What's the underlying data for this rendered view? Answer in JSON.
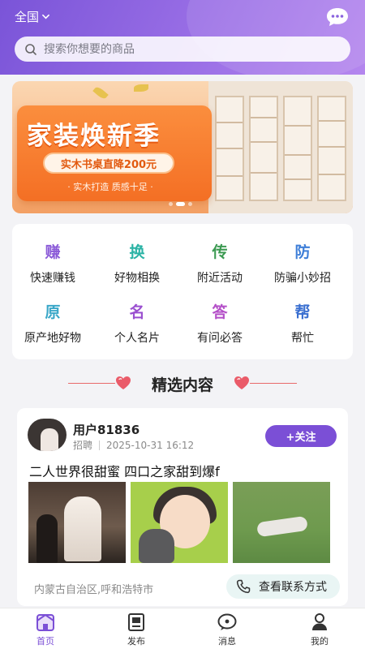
{
  "header": {
    "region": "全国",
    "search_placeholder": "搜索你想要的商品",
    "accent": "#7b4fd6"
  },
  "banner": {
    "title": "家装焕新季",
    "promo": "实木书桌直降200元",
    "subtitle": "· 实木打造 质感十足 ·",
    "slides_total": 3,
    "slide_active": 2
  },
  "quick_grid": [
    {
      "icon_char": "赚",
      "label": "快速赚钱",
      "color": "#8b5bd8"
    },
    {
      "icon_char": "换",
      "label": "好物相换",
      "color": "#2bb3a5"
    },
    {
      "icon_char": "传",
      "label": "附近活动",
      "color": "#3c9a52"
    },
    {
      "icon_char": "防",
      "label": "防骗小妙招",
      "color": "#3f7fd8"
    },
    {
      "icon_char": "原",
      "label": "原产地好物",
      "color": "#3aa7c8"
    },
    {
      "icon_char": "名",
      "label": "个人名片",
      "color": "#9a4fd0"
    },
    {
      "icon_char": "答",
      "label": "有问必答",
      "color": "#b44fc8"
    },
    {
      "icon_char": "帮",
      "label": "帮忙",
      "color": "#3a6fd0"
    }
  ],
  "section": {
    "title": "精选内容"
  },
  "post": {
    "username": "用户81836",
    "category": "招聘",
    "time": "2025-10-31 16:12",
    "follow_label": "+关注",
    "title": "二人世界很甜蜜 四口之家甜到爆f",
    "location": "内蒙古自治区,呼和浩特市",
    "contact_label": "查看联系方式"
  },
  "tabbar": [
    {
      "label": "首页",
      "icon": "home-icon",
      "active": true
    },
    {
      "label": "发布",
      "icon": "publish-icon",
      "active": false
    },
    {
      "label": "消息",
      "icon": "message-icon",
      "active": false
    },
    {
      "label": "我的",
      "icon": "profile-icon",
      "active": false
    }
  ]
}
